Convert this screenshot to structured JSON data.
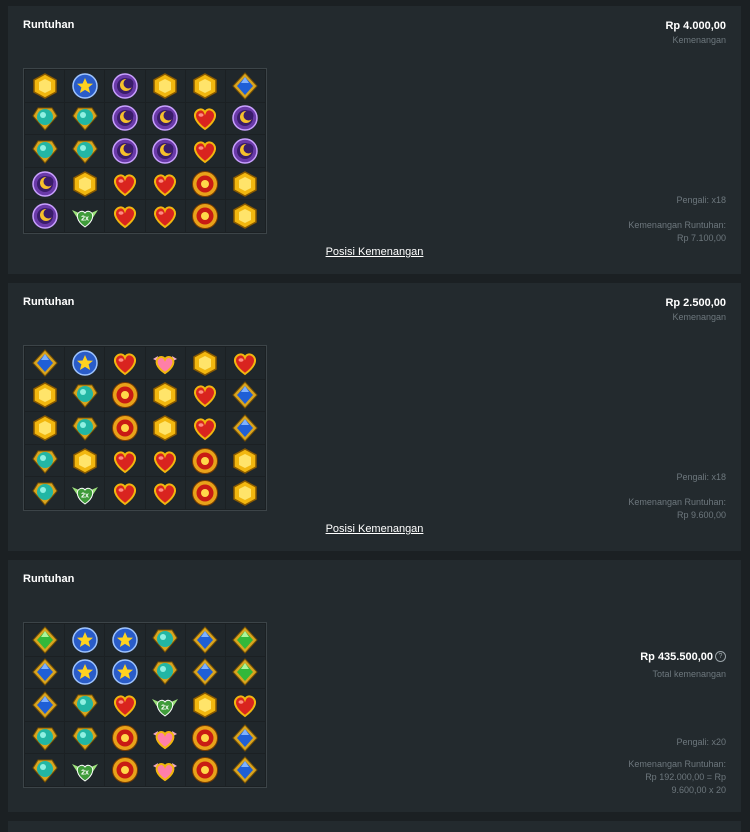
{
  "cards": [
    {
      "title": "Runtuhan",
      "amount": "Rp 4.000,00",
      "amount_label": "Kemenangan",
      "multiplier": "Pengali: x18",
      "cascade_label": "Kemenangan Runtuhan:",
      "cascade_value": "Rp 7.100,00",
      "link": "Posisi Kemenangan",
      "grid": [
        [
          "gold",
          "star",
          "moon",
          "gold",
          "gold",
          "blue"
        ],
        [
          "teal",
          "teal",
          "moon",
          "moon",
          "heart",
          "moon"
        ],
        [
          "teal",
          "teal",
          "moon",
          "moon",
          "heart",
          "moon"
        ],
        [
          "moon",
          "gold",
          "heart",
          "heart",
          "sun",
          "gold"
        ],
        [
          "moon",
          "wild",
          "heart",
          "heart",
          "sun",
          "gold"
        ]
      ]
    },
    {
      "title": "Runtuhan",
      "amount": "Rp 2.500,00",
      "amount_label": "Kemenangan",
      "multiplier": "Pengali: x18",
      "cascade_label": "Kemenangan Runtuhan:",
      "cascade_value": "Rp 9.600,00",
      "link": "Posisi Kemenangan",
      "grid": [
        [
          "blue",
          "star",
          "heart",
          "pink",
          "gold",
          "heart"
        ],
        [
          "gold",
          "teal",
          "sun",
          "gold",
          "heart",
          "blue"
        ],
        [
          "gold",
          "teal",
          "sun",
          "gold",
          "heart",
          "blue"
        ],
        [
          "teal",
          "gold",
          "heart",
          "heart",
          "sun",
          "gold"
        ],
        [
          "teal",
          "wild",
          "heart",
          "heart",
          "sun",
          "gold"
        ]
      ]
    },
    {
      "title": "Runtuhan",
      "total_amount": "Rp 435.500,00",
      "total_label": "Total kemenangan",
      "help_symbol": "?",
      "multiplier": "Pengali: x20",
      "cascade_label": "Kemenangan Runtuhan:",
      "cascade_value_line1": "Rp 192.000,00 = Rp",
      "cascade_value_line2": "9.600,00 x 20",
      "grid": [
        [
          "green",
          "star",
          "star",
          "teal",
          "blue",
          "green"
        ],
        [
          "blue",
          "star",
          "star",
          "teal",
          "blue",
          "green"
        ],
        [
          "blue",
          "teal",
          "heart",
          "wild",
          "gold",
          "heart"
        ],
        [
          "teal",
          "teal",
          "sun",
          "pink",
          "sun",
          "blue"
        ],
        [
          "teal",
          "wild",
          "sun",
          "pink",
          "sun",
          "blue"
        ]
      ]
    }
  ],
  "wild_label": "2x",
  "colors": {
    "background": "#1b2023",
    "card": "#232a2e",
    "muted_text": "#6d777d"
  }
}
